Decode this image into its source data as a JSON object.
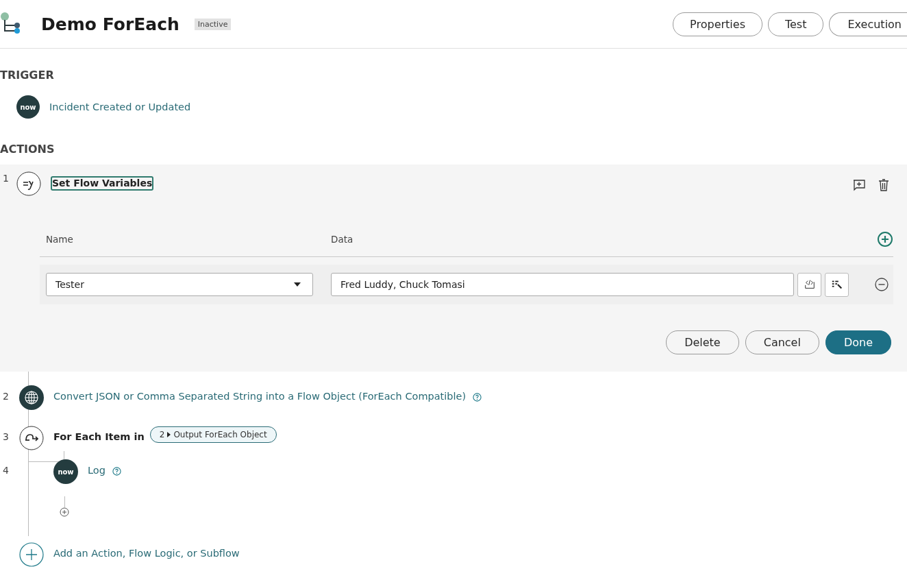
{
  "header": {
    "title": "Demo ForEach",
    "status": "Inactive",
    "buttons": [
      "Properties",
      "Test",
      "Execution"
    ]
  },
  "trigger": {
    "heading": "TRIGGER",
    "label": "Incident Created or Updated",
    "logo": "now"
  },
  "actions": {
    "heading": "ACTIONS",
    "expanded": {
      "number": "1",
      "label": "Set Flow Variables",
      "focused": true,
      "columns": [
        "Name",
        "Data"
      ],
      "variables": [
        {
          "name": "Tester",
          "data": "Fred Luddy, Chuck Tomasi"
        }
      ],
      "buttons": [
        {
          "label": "Delete",
          "kind": "secondary"
        },
        {
          "label": "Cancel",
          "kind": "secondary"
        },
        {
          "label": "Done",
          "kind": "primary"
        }
      ]
    },
    "steps": [
      {
        "number": "2",
        "kind": "action",
        "label": "Convert JSON or Comma Separated String into a Flow Object (ForEach Compatible)",
        "help": true
      },
      {
        "number": "3",
        "kind": "for-each",
        "label": "For Each Item in",
        "pill": {
          "step": "2",
          "text": "Output ForEach Object"
        },
        "help": false,
        "children": [
          {
            "number": "4",
            "kind": "core",
            "logo": "now",
            "label": "Log",
            "help": true
          }
        ]
      }
    ],
    "add_label": "Add an Action, Flow Logic, or Subflow"
  }
}
